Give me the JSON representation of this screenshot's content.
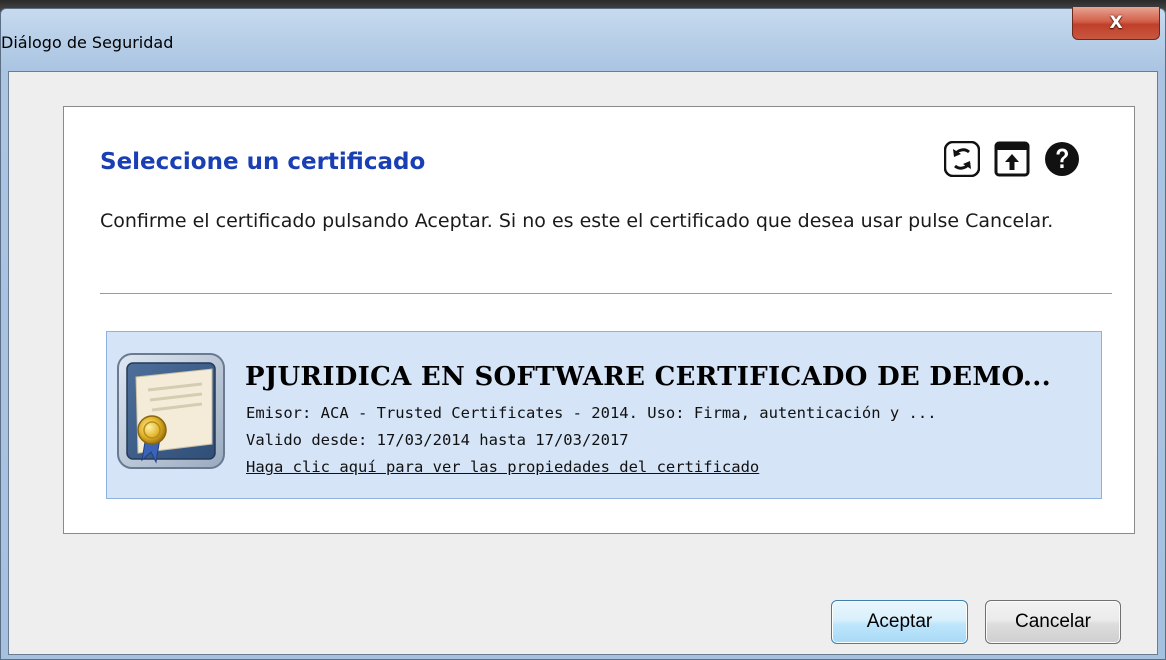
{
  "window": {
    "title": "Diálogo de Seguridad",
    "close_label": "X"
  },
  "panel": {
    "title": "Seleccione un certificado",
    "description": "Confirme el certificado pulsando Aceptar. Si no es este el certificado que desea usar pulse Cancelar.",
    "toolbar_icons": [
      "refresh-icon",
      "import-icon",
      "help-icon"
    ]
  },
  "certificate": {
    "name": "PJURIDICA EN SOFTWARE CERTIFICADO DE DEMO...",
    "issuer_line": "Emisor: ACA - Trusted Certificates - 2014. Uso: Firma, autenticación y ...",
    "validity_line": "Valido desde: 17/03/2014 hasta 17/03/2017",
    "properties_link": "Haga clic aquí para ver las propiedades del certificado",
    "icon": "certificate-icon"
  },
  "buttons": {
    "accept_label": "Aceptar",
    "cancel_label": "Cancelar"
  },
  "colors": {
    "title_blue": "#1a3fb4",
    "card_bg": "#d5e4f7",
    "card_border": "#8fb1e0",
    "close_red": "#c9573f"
  }
}
